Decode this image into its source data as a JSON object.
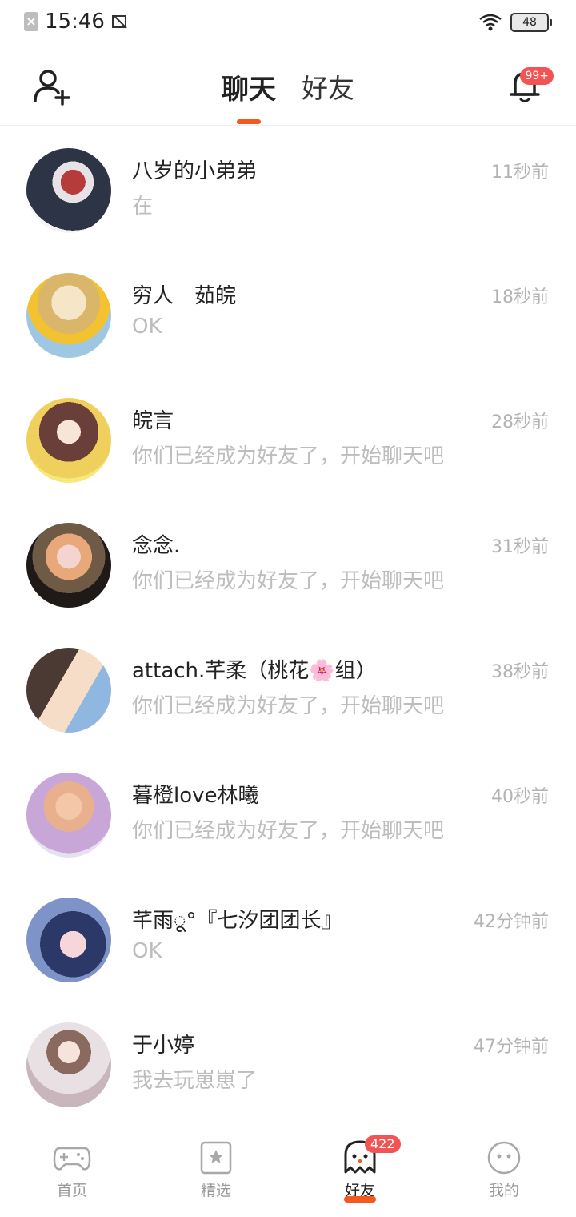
{
  "status_bar": {
    "time": "15:46",
    "battery": "48"
  },
  "header": {
    "tabs": [
      {
        "label": "聊天"
      },
      {
        "label": "好友"
      }
    ],
    "notification_badge": "99+"
  },
  "chats": [
    {
      "name": "八岁的小弟弟",
      "preview": "在",
      "time": "11秒前",
      "avatar_color": "#5c6f8f"
    },
    {
      "name": "穷人　茹皖",
      "preview": "OK",
      "time": "18秒前",
      "avatar_color": "#d9b66a"
    },
    {
      "name": "皖言",
      "preview": "你们已经成为好友了，开始聊天吧",
      "time": "28秒前",
      "avatar_color": "#e8c65c"
    },
    {
      "name": "念念.",
      "preview": "你们已经成为好友了，开始聊天吧",
      "time": "31秒前",
      "avatar_color": "#3a2b26"
    },
    {
      "name": "attach.芊柔（桃花🌸组）",
      "preview": "你们已经成为好友了，开始聊天吧",
      "time": "38秒前",
      "avatar_color": "#5a4a43"
    },
    {
      "name": "暮橙love林曦",
      "preview": "你们已经成为好友了，开始聊天吧",
      "time": "40秒前",
      "avatar_color": "#d8a9c4"
    },
    {
      "name": "芊雨ू°『七汐团团长』",
      "preview": "OK",
      "time": "42分钟前",
      "avatar_color": "#3b4d7a"
    },
    {
      "name": "于小婷",
      "preview": "我去玩崽崽了",
      "time": "47分钟前",
      "avatar_color": "#d9c3c3"
    }
  ],
  "bottom_nav": [
    {
      "label": "首页",
      "icon": "gamepad-icon"
    },
    {
      "label": "精选",
      "icon": "star-bookmark-icon"
    },
    {
      "label": "好友",
      "icon": "ghost-icon",
      "badge": "422"
    },
    {
      "label": "我的",
      "icon": "face-icon"
    }
  ],
  "colors": {
    "accent": "#f25a1e",
    "badge": "#f25454"
  }
}
